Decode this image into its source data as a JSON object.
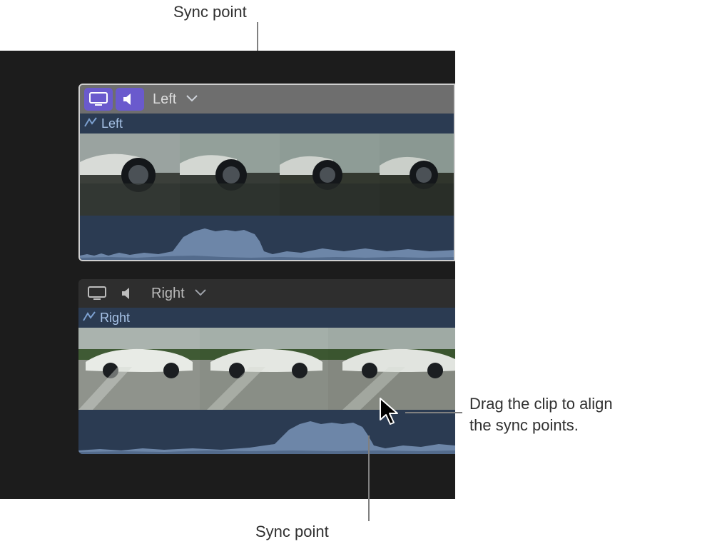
{
  "annotations": {
    "top_label": "Sync point",
    "bottom_label": "Sync point",
    "side_label_line1": "Drag the clip to align",
    "side_label_line2": "the sync points."
  },
  "lanes": [
    {
      "id": "left",
      "name": "Left",
      "clip_name": "Left",
      "active": true
    },
    {
      "id": "right",
      "name": "Right",
      "clip_name": "Right",
      "active": false
    }
  ],
  "icons": {
    "monitor": "monitor-icon",
    "speaker": "speaker-icon",
    "chevron": "chevron-down-icon",
    "clip": "clip-angle-icon"
  }
}
